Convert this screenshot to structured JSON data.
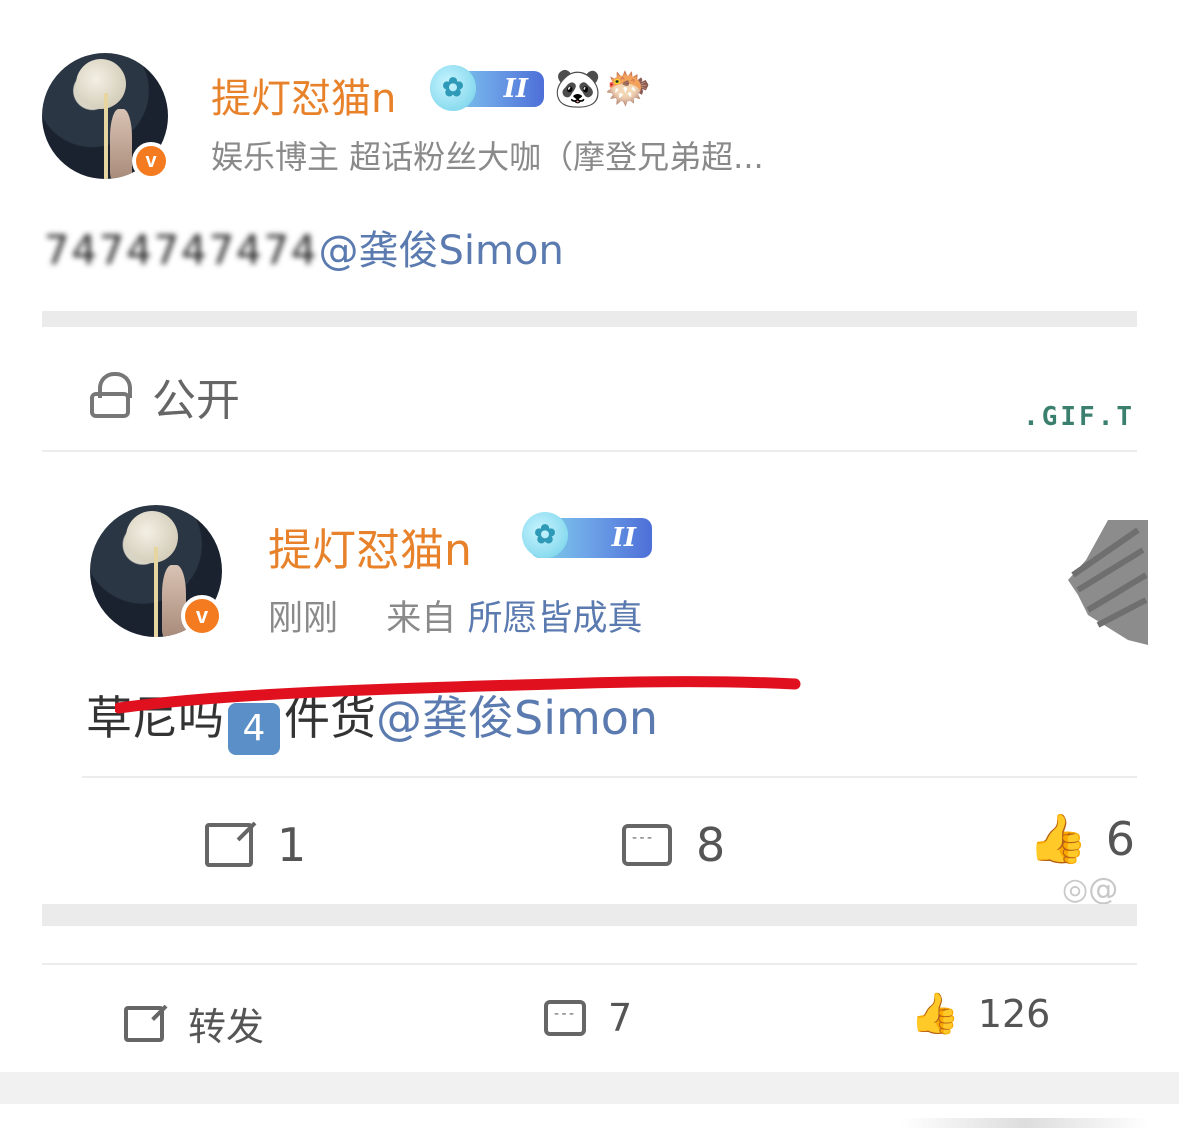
{
  "top_post": {
    "author_name": "提灯怼猫n",
    "badge_label": "II",
    "meta": "娱乐博主 超话粉丝大咖（摩登兄弟超...",
    "text_blurred": "7474747474",
    "mention": "@龚俊Simon"
  },
  "repost_card": {
    "privacy_label": "公开",
    "gift_label": ".GIF.T",
    "author_name": "提灯怼猫n",
    "badge_label": "II",
    "time": "刚刚",
    "source_prefix": "来自",
    "source_name": "所愿皆成真",
    "text": "草尼吗",
    "keycap": "4",
    "text_after": "件货",
    "mention": "@龚俊Simon",
    "actions": {
      "share_count": "1",
      "comment_count": "8",
      "like_count": "6"
    },
    "watermark": "@"
  },
  "post_actions": {
    "share_label": "转发",
    "comment_count": "7",
    "like_count": "126"
  },
  "colors": {
    "name_orange": "#e8822a",
    "mention_blue": "#5b7bb0",
    "verified_orange": "#f47b20",
    "strike_red": "#e0101f"
  }
}
